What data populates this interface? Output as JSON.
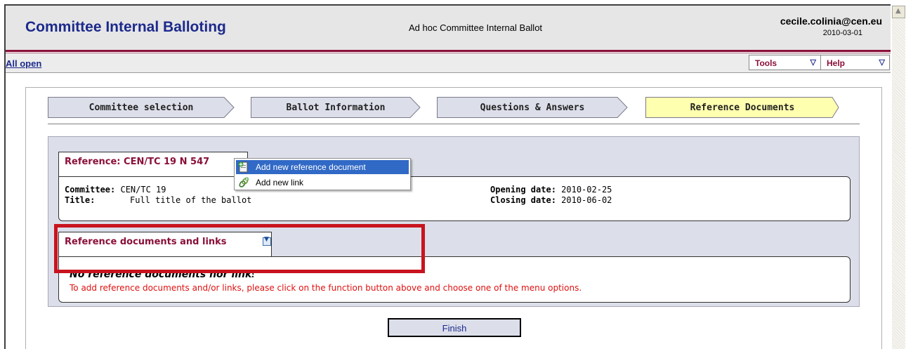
{
  "header": {
    "app_title": "Committee Internal Balloting",
    "ballot_type": "Ad hoc Committee Internal Ballot",
    "user_email": "cecile.colinia@cen.eu",
    "user_date": "2010-03-01"
  },
  "navbar": {
    "all_open": "All open",
    "tools_label": "Tools",
    "help_label": "Help"
  },
  "steps": [
    {
      "label": "Committee selection",
      "active": false
    },
    {
      "label": "Ballot Information",
      "active": false
    },
    {
      "label": "Questions & Answers",
      "active": false
    },
    {
      "label": "Reference Documents",
      "active": true
    }
  ],
  "reference": {
    "tab_label": "Reference: CEN/TC 19 N 547",
    "committee_key": "Committee:",
    "committee_value": "CEN/TC 19",
    "title_key": "Title:",
    "title_value": "Full title of the ballot",
    "opening_key": "Opening date:",
    "opening_value": "2010-02-25",
    "closing_key": "Closing date:",
    "closing_value": "2010-06-02"
  },
  "documents": {
    "tab_label": "Reference documents and links",
    "empty_message": "No reference documents nor links",
    "hint": "To add reference documents and/or links, please click on the function button above and choose one of the menu options."
  },
  "context_menu": {
    "items": [
      {
        "label": "Add new reference document",
        "icon": "add-document-icon",
        "selected": true
      },
      {
        "label": "Add new link",
        "icon": "add-link-icon",
        "selected": false
      }
    ]
  },
  "actions": {
    "finish_label": "Finish"
  },
  "colors": {
    "brand_blue": "#1c2a8c",
    "brand_maroon": "#8a1038",
    "active_step": "#ffffb0",
    "inactive_step": "#dcdfea",
    "highlight_red": "#c8141e",
    "hint_red": "#e01010",
    "menu_selected": "#3169c6"
  }
}
